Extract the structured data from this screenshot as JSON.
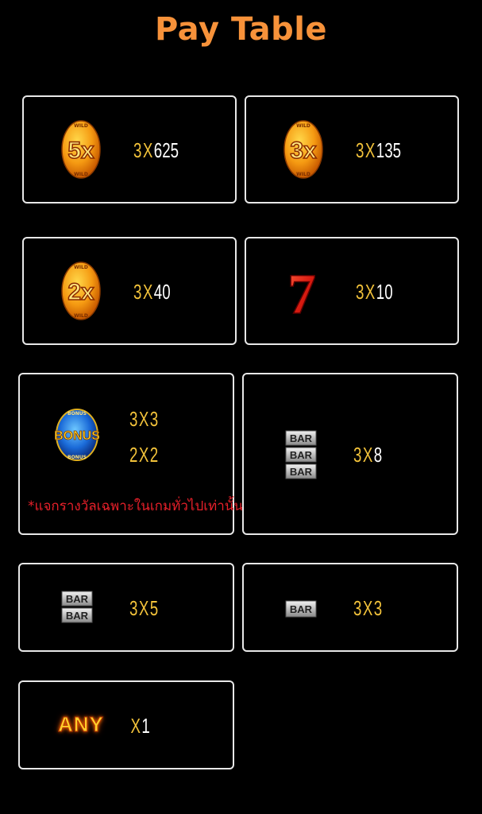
{
  "title": "Pay Table",
  "symbols": {
    "wild5x": {
      "icon": "wild-5x-icon",
      "text": "5x",
      "ring": "WILD",
      "count": "3",
      "x": "X",
      "amount": "625"
    },
    "wild3x": {
      "icon": "wild-3x-icon",
      "text": "3x",
      "ring": "WILD",
      "count": "3",
      "x": "X",
      "amount": "135"
    },
    "wild2x": {
      "icon": "wild-2x-icon",
      "text": "2x",
      "ring": "WILD",
      "count": "3",
      "x": "X",
      "amount": "40"
    },
    "seven": {
      "icon": "red-seven-icon",
      "text": "7",
      "count": "3",
      "x": "X",
      "amount": "10"
    },
    "bonus": {
      "icon": "bonus-icon",
      "text": "BONUS",
      "ring": "BONUS",
      "pays": [
        {
          "count": "3",
          "x": "X",
          "amount": "3"
        },
        {
          "count": "2",
          "x": "X",
          "amount": "2"
        }
      ],
      "note": "*แจกรางวัลเฉพาะในเกมทั่วไปเท่านั้น"
    },
    "triple_bar": {
      "icon": "triple-bar-icon",
      "bar": "BAR",
      "count": "3",
      "x": "X",
      "amount": "8"
    },
    "double_bar": {
      "icon": "double-bar-icon",
      "bar": "BAR",
      "count": "3",
      "x": "X",
      "amount": "5"
    },
    "single_bar": {
      "icon": "single-bar-icon",
      "bar": "BAR",
      "count": "3",
      "x": "X",
      "amount": "3"
    },
    "any": {
      "icon": "any-bar-icon",
      "text": "ANY",
      "x": "X",
      "amount": "1"
    }
  },
  "colors": {
    "title": "#f7923a",
    "count": "#f2c23a",
    "note": "#e8202a",
    "border": "#e8e8e8"
  }
}
